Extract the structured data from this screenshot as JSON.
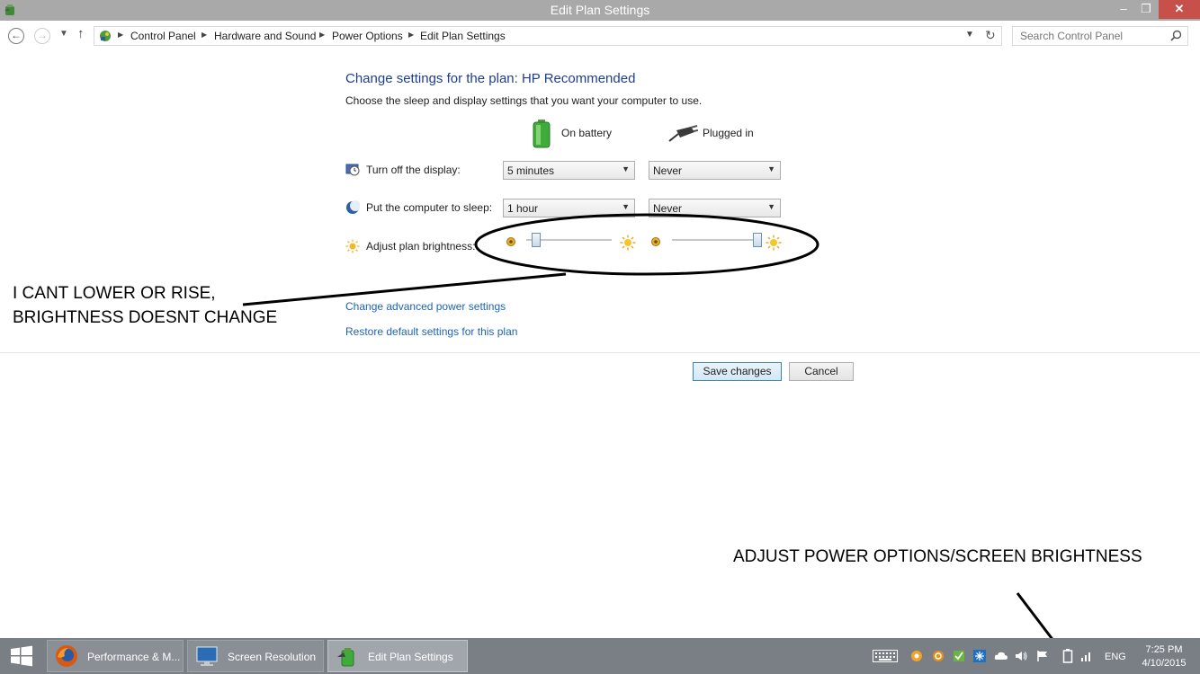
{
  "window": {
    "title": "Edit Plan Settings",
    "minimize_glyph": "–",
    "maximize_glyph": "❐",
    "close_glyph": "✕"
  },
  "address_bar": {
    "breadcrumbs": [
      "Control Panel",
      "Hardware and Sound",
      "Power Options",
      "Edit Plan Settings"
    ],
    "search_placeholder": "Search Control Panel"
  },
  "content": {
    "heading": "Change settings for the plan: HP Recommended",
    "subheading": "Choose the sleep and display settings that you want your computer to use.",
    "columns": {
      "on_battery": "On battery",
      "plugged_in": "Plugged in"
    },
    "rows": {
      "display": {
        "label": "Turn off the display:",
        "battery_value": "5 minutes",
        "plugged_value": "Never"
      },
      "sleep": {
        "label": "Put the computer to sleep:",
        "battery_value": "1 hour",
        "plugged_value": "Never"
      },
      "brightness": {
        "label": "Adjust plan brightness:",
        "battery_level": 0.12,
        "plugged_level": 1.0
      }
    },
    "links": {
      "advanced": "Change advanced power settings",
      "restore": "Restore default settings for this plan"
    },
    "buttons": {
      "save": "Save changes",
      "cancel": "Cancel"
    }
  },
  "annotations": {
    "brightness_note": [
      "I CANT LOWER OR RISE,",
      "BRIGHTNESS DOESNT CHANGE"
    ],
    "tray_note": "ADJUST POWER OPTIONS/SCREEN BRIGHTNESS"
  },
  "taskbar": {
    "items": [
      {
        "label": "Performance & M...",
        "icon": "firefox-icon"
      },
      {
        "label": "Screen Resolution",
        "icon": "screen-resolution-icon"
      },
      {
        "label": "Edit Plan Settings",
        "icon": "power-plan-icon"
      }
    ],
    "language": "ENG",
    "time": "7:25 PM",
    "date": "4/10/2015"
  },
  "colors": {
    "title_bar": "#a9a9a9",
    "close_button": "#c7504a",
    "heading": "#1e3e8f",
    "link": "#1c63b7",
    "taskbar": "#7a7f86"
  }
}
